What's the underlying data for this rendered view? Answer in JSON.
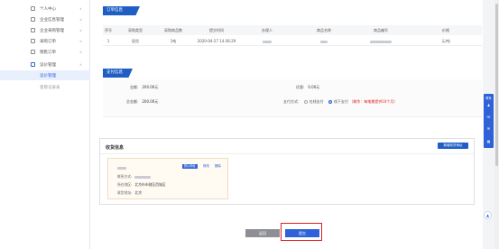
{
  "sidebar": {
    "items": [
      {
        "label": "个人中心"
      },
      {
        "label": "企业信息管理"
      },
      {
        "label": "企业采购管理"
      },
      {
        "label": "采购订单"
      },
      {
        "label": "销售订单"
      },
      {
        "label": "议价管理"
      },
      {
        "label": "议价管理"
      },
      {
        "label": "意愿记录表"
      }
    ]
  },
  "order_info": {
    "title": "订单信息",
    "headers": [
      "序号",
      "采购类型",
      "采购商品数",
      "提交时间",
      "办理人",
      "商品名称",
      "商品编号",
      "价格"
    ],
    "rows": [
      [
        "1",
        "现货",
        "1吨",
        "2020-04-27 14:36:29",
        "",
        "",
        "",
        "元/吨"
      ]
    ]
  },
  "pay_info": {
    "title": "支付信息",
    "amount_label": "金额:",
    "amount_value": "200.00元",
    "discount_label": "优惠:",
    "discount_value": "0.00元",
    "total_label": "总金额:",
    "total_value": "200.00元",
    "method_label": "支付方式:",
    "option_online": "在线支付",
    "option_offline": "线下支付",
    "offline_note": "（剩余：每笔需提供10个月）"
  },
  "address": {
    "title": "收货信息",
    "new_button": "新增收货地址",
    "card": {
      "default_tag": "默认地址",
      "edit_link": "修改",
      "delete_link": "删除",
      "contact_label": "联系方式:",
      "region_label": "所在地区:",
      "region_value": "北京市市辖区西城区",
      "detail_label": "收货地址:",
      "detail_value": "北京"
    }
  },
  "actions": {
    "back": "返回",
    "submit": "提交"
  },
  "side_widget": {
    "label": "联系"
  },
  "colors": {
    "primary": "#1f5fc4",
    "highlight": "#e02020"
  }
}
